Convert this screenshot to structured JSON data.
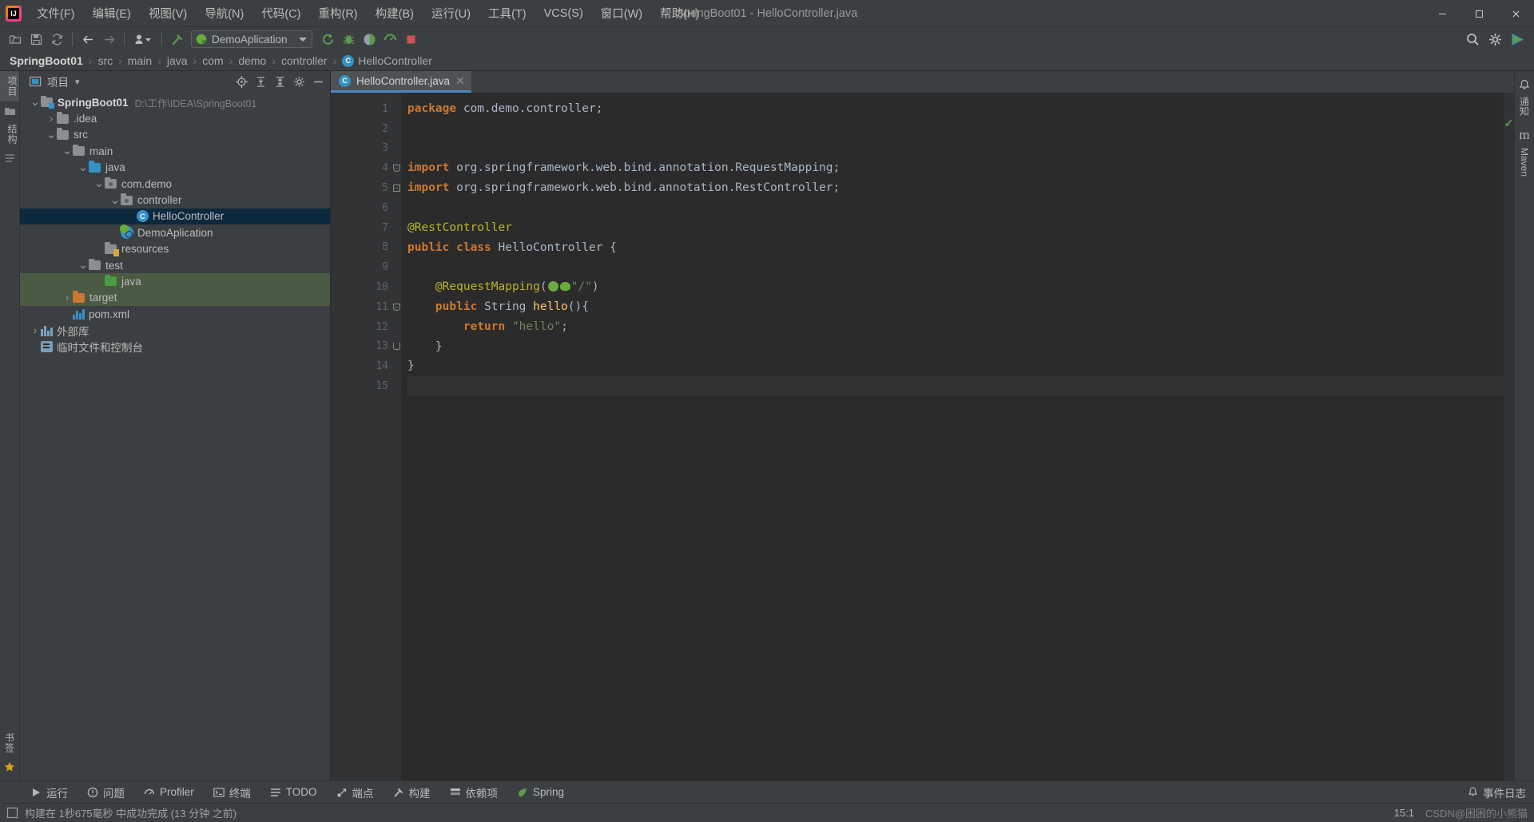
{
  "window": {
    "title": "SpringBoot01 - HelloController.java",
    "minimize_label": "─",
    "maximize_label": "❐",
    "close_label": "✕"
  },
  "menu": {
    "items": [
      {
        "label": "文件(F)",
        "name": "menu-file"
      },
      {
        "label": "编辑(E)",
        "name": "menu-edit"
      },
      {
        "label": "视图(V)",
        "name": "menu-view"
      },
      {
        "label": "导航(N)",
        "name": "menu-navigate"
      },
      {
        "label": "代码(C)",
        "name": "menu-code"
      },
      {
        "label": "重构(R)",
        "name": "menu-refactor"
      },
      {
        "label": "构建(B)",
        "name": "menu-build"
      },
      {
        "label": "运行(U)",
        "name": "menu-run"
      },
      {
        "label": "工具(T)",
        "name": "menu-tools"
      },
      {
        "label": "VCS(S)",
        "name": "menu-vcs"
      },
      {
        "label": "窗口(W)",
        "name": "menu-window"
      },
      {
        "label": "帮助(H)",
        "name": "menu-help"
      }
    ]
  },
  "toolbar": {
    "run_config": "DemoAplication",
    "icons": [
      "open-folder-icon",
      "save-icon",
      "sync-icon",
      "back-arrow-icon",
      "forward-arrow-icon",
      "user-dropdown-icon",
      "build-hammer-icon"
    ],
    "right_icons": [
      "search-icon",
      "settings-gear-icon",
      "plugin-icon"
    ],
    "run_icons": [
      "run-icon",
      "debug-icon",
      "run-with-coverage-icon",
      "profiler-icon",
      "stop-icon"
    ]
  },
  "breadcrumb": {
    "items": [
      "SpringBoot01",
      "src",
      "main",
      "java",
      "com",
      "demo",
      "controller"
    ],
    "final_item": "HelloController",
    "separator": "›"
  },
  "left_rail": {
    "project_label": "项目",
    "bookmark_label": "书签",
    "structure_label": "结构"
  },
  "right_rail": {
    "notification_label": "通知",
    "maven_label": "Maven",
    "maven_icon": "m"
  },
  "project_panel": {
    "title": "项目",
    "dropdown_caret": "▾",
    "actions": [
      "locate-file-icon",
      "collapse-all-icon",
      "expand-all-icon",
      "settings-gear-icon",
      "hide-panel-icon"
    ],
    "tree": [
      {
        "label": "SpringBoot01",
        "path": "D:\\工作\\IDEA\\SpringBoot01",
        "depth": 0,
        "icon": "module-folder",
        "twist": "⌄",
        "bold": true
      },
      {
        "label": ".idea",
        "depth": 1,
        "icon": "folder",
        "twist": "›"
      },
      {
        "label": "src",
        "depth": 1,
        "icon": "folder",
        "twist": "⌄"
      },
      {
        "label": "main",
        "depth": 2,
        "icon": "folder",
        "twist": "⌄"
      },
      {
        "label": "java",
        "depth": 3,
        "icon": "source-folder-blue",
        "twist": "⌄"
      },
      {
        "label": "com.demo",
        "depth": 4,
        "icon": "package-folder",
        "twist": "⌄"
      },
      {
        "label": "controller",
        "depth": 5,
        "icon": "package-folder",
        "twist": "⌄"
      },
      {
        "label": "HelloController",
        "depth": 6,
        "icon": "java-class",
        "twist": "",
        "selected": true
      },
      {
        "label": "DemoAplication",
        "depth": 5,
        "icon": "spring-boot-class",
        "twist": ""
      },
      {
        "label": "resources",
        "depth": 4,
        "icon": "resources-folder",
        "twist": ""
      },
      {
        "label": "test",
        "depth": 3,
        "icon": "folder",
        "twist": "⌄"
      },
      {
        "label": "java",
        "depth": 4,
        "icon": "test-source-folder-green",
        "twist": "",
        "highlight": "green"
      },
      {
        "label": "target",
        "depth": 2,
        "icon": "excluded-folder-orange",
        "twist": "›",
        "highlight": "green"
      },
      {
        "label": "pom.xml",
        "depth": 2,
        "icon": "maven-file",
        "twist": ""
      },
      {
        "label": "外部库",
        "depth": 0,
        "icon": "library",
        "twist": "›"
      },
      {
        "label": "临时文件和控制台",
        "depth": 0,
        "icon": "scratches",
        "twist": ""
      }
    ]
  },
  "editor": {
    "tab": {
      "label": "HelloController.java",
      "icon": "java-class-icon",
      "close": "✕"
    },
    "inspection_status": "✓",
    "lines": [
      {
        "n": 1,
        "tokens": [
          {
            "t": "package ",
            "c": "kw"
          },
          {
            "t": "com.demo.controller;",
            "c": "plain"
          }
        ]
      },
      {
        "n": 2,
        "tokens": []
      },
      {
        "n": 3,
        "tokens": []
      },
      {
        "n": 4,
        "fold": "minus-round",
        "tokens": [
          {
            "t": "import ",
            "c": "kw"
          },
          {
            "t": "org.springframework.web.bind.annotation.RequestMapping;",
            "c": "plain"
          }
        ]
      },
      {
        "n": 5,
        "fold": "minus",
        "tokens": [
          {
            "t": "import ",
            "c": "kw"
          },
          {
            "t": "org.springframework.web.bind.annotation.RestController;",
            "c": "plain"
          }
        ]
      },
      {
        "n": 6,
        "tokens": []
      },
      {
        "n": 7,
        "gutter_icon": "spring-bean-run-icon",
        "tokens": [
          {
            "t": "@RestController",
            "c": "ann"
          }
        ]
      },
      {
        "n": 8,
        "gutter_icon": "spring-bean-icon",
        "tokens": [
          {
            "t": "public ",
            "c": "kw"
          },
          {
            "t": "class ",
            "c": "kw"
          },
          {
            "t": "HelloController",
            "c": "cls"
          },
          {
            "t": " {",
            "c": "plain"
          }
        ]
      },
      {
        "n": 9,
        "tokens": []
      },
      {
        "n": 10,
        "tokens": [
          {
            "t": "    ",
            "c": "plain"
          },
          {
            "t": "@RequestMapping",
            "c": "ann"
          },
          {
            "t": "(",
            "c": "plain"
          },
          {
            "t": "◉",
            "c": "icon"
          },
          {
            "t": "◑",
            "c": "icon2"
          },
          {
            "t": "\"/\"",
            "c": "str"
          },
          {
            "t": ")",
            "c": "plain"
          }
        ]
      },
      {
        "n": 11,
        "gutter_icon": "spring-bean-icon",
        "fold": "minus-round",
        "tokens": [
          {
            "t": "    ",
            "c": "plain"
          },
          {
            "t": "public ",
            "c": "kw"
          },
          {
            "t": "String ",
            "c": "cls"
          },
          {
            "t": "hello",
            "c": "mth"
          },
          {
            "t": "(){",
            "c": "plain"
          }
        ]
      },
      {
        "n": 12,
        "tokens": [
          {
            "t": "        ",
            "c": "plain"
          },
          {
            "t": "return ",
            "c": "kw"
          },
          {
            "t": "\"hello\"",
            "c": "str"
          },
          {
            "t": ";",
            "c": "plain"
          }
        ]
      },
      {
        "n": 13,
        "fold": "end",
        "tokens": [
          {
            "t": "    }",
            "c": "plain"
          }
        ]
      },
      {
        "n": 14,
        "tokens": [
          {
            "t": "}",
            "c": "plain"
          }
        ]
      },
      {
        "n": 15,
        "tokens": [],
        "current": true
      }
    ]
  },
  "toolwindow_bar": {
    "items": [
      {
        "label": "运行",
        "icon": "run-icon",
        "name": "toolwindow-run"
      },
      {
        "label": "问题",
        "icon": "problems-icon",
        "name": "toolwindow-problems"
      },
      {
        "label": "Profiler",
        "icon": "profiler-icon",
        "name": "toolwindow-profiler"
      },
      {
        "label": "终端",
        "icon": "terminal-icon",
        "name": "toolwindow-terminal"
      },
      {
        "label": "TODO",
        "icon": "todo-icon",
        "name": "toolwindow-todo"
      },
      {
        "label": "端点",
        "icon": "endpoints-icon",
        "name": "toolwindow-endpoints"
      },
      {
        "label": "构建",
        "icon": "build-hammer-icon",
        "name": "toolwindow-build"
      },
      {
        "label": "依赖项",
        "icon": "dependencies-icon",
        "name": "toolwindow-dependencies"
      },
      {
        "label": "Spring",
        "icon": "spring-leaf-icon",
        "name": "toolwindow-spring"
      }
    ],
    "event_log": {
      "label": "事件日志",
      "icon": "bell-icon"
    }
  },
  "statusbar": {
    "message": "构建在 1秒675毫秒 中成功完成 (13 分钟 之前)",
    "caret_position": "15:1",
    "watermark": "CSDN@困困的小熊猫"
  },
  "colors": {
    "accent_blue": "#3592c4",
    "tab_underline": "#4a88c7",
    "selection": "#0d293e",
    "keyword": "#cc7832",
    "annotation": "#bbb529",
    "string": "#6a8759",
    "method": "#ffc66d",
    "editor_bg": "#2b2b2b",
    "panel_bg": "#3c3f41"
  }
}
